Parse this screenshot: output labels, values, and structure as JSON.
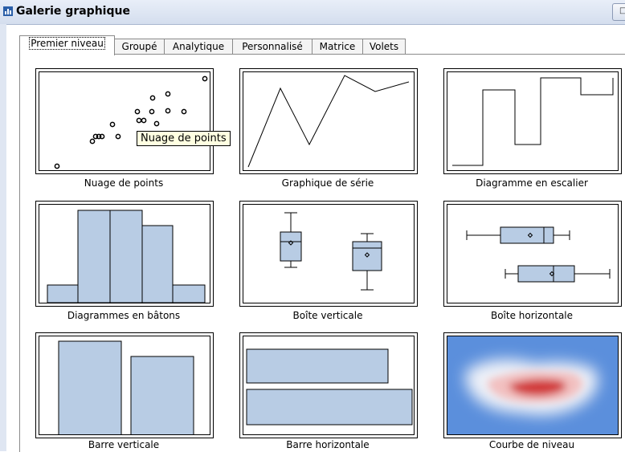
{
  "window": {
    "title": "Galerie graphique",
    "title_button_glyph": "□",
    "app_icon": "chart-gallery-icon"
  },
  "tabs": [
    {
      "label": "Premier niveau",
      "active": true
    },
    {
      "label": "Groupé",
      "active": false
    },
    {
      "label": "Analytique",
      "active": false
    },
    {
      "label": "Personnalisé",
      "active": false
    },
    {
      "label": "Matrice",
      "active": false
    },
    {
      "label": "Volets",
      "active": false
    }
  ],
  "gallery": {
    "items": [
      {
        "label": "Nuage de points",
        "kind": "scatter"
      },
      {
        "label": "Graphique de série",
        "kind": "series-line"
      },
      {
        "label": "Diagramme en escalier",
        "kind": "step"
      },
      {
        "label": "Diagrammes en bâtons",
        "kind": "histogram"
      },
      {
        "label": "Boîte verticale",
        "kind": "vertical-boxplot"
      },
      {
        "label": "Boîte horizontale",
        "kind": "horizontal-boxplot"
      },
      {
        "label": "Barre verticale",
        "kind": "vertical-bar"
      },
      {
        "label": "Barre horizontale",
        "kind": "horizontal-bar"
      },
      {
        "label": "Courbe de niveau",
        "kind": "contour"
      }
    ]
  },
  "tooltip": {
    "text": "Nuage de points"
  },
  "colors": {
    "bar_fill": "#b8cce4",
    "contour_low": "#5b8fdc",
    "contour_high": "#d23a3a",
    "tooltip_bg": "#ffffe1"
  }
}
